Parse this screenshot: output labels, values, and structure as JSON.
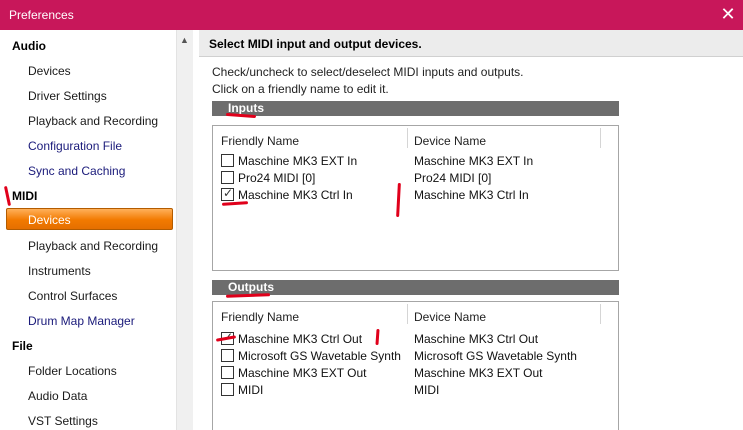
{
  "window": {
    "title": "Preferences",
    "close_icon": "close-icon"
  },
  "sidebar": {
    "sections": [
      {
        "label": "Audio",
        "items": [
          "Devices",
          "Driver Settings",
          "Playback and Recording",
          "Configuration File",
          "Sync and Caching"
        ]
      },
      {
        "label": "MIDI",
        "items": [
          "Devices",
          "Playback and Recording",
          "Instruments",
          "Control Surfaces",
          "Drum Map Manager"
        ]
      },
      {
        "label": "File",
        "items": [
          "Folder Locations",
          "Audio Data",
          "VST Settings"
        ]
      }
    ],
    "selected": "MIDI / Devices"
  },
  "main": {
    "header": "Select MIDI input and output devices.",
    "instructions": [
      "Check/uncheck to select/deselect MIDI inputs and outputs.",
      "Click on a friendly name to edit it."
    ],
    "inputs": {
      "title": "Inputs",
      "col_friendly": "Friendly Name",
      "col_device": "Device Name",
      "rows": [
        {
          "friendly": "Maschine MK3 EXT In",
          "device": "Maschine MK3 EXT In",
          "checked": false
        },
        {
          "friendly": "Pro24 MIDI [0]",
          "device": "Pro24 MIDI [0]",
          "checked": false
        },
        {
          "friendly": "Maschine MK3 Ctrl In",
          "device": "Maschine MK3 Ctrl In",
          "checked": true
        }
      ]
    },
    "outputs": {
      "title": "Outputs",
      "col_friendly": "Friendly Name",
      "col_device": "Device Name",
      "rows": [
        {
          "friendly": "Maschine MK3 Ctrl Out",
          "device": "Maschine MK3 Ctrl Out",
          "checked": true
        },
        {
          "friendly": "Microsoft GS Wavetable Synth",
          "device": "Microsoft GS Wavetable Synth",
          "checked": false
        },
        {
          "friendly": "Maschine MK3 EXT Out",
          "device": "Maschine MK3 EXT Out",
          "checked": false
        },
        {
          "friendly": "MIDI",
          "device": "MIDI",
          "checked": false
        }
      ]
    }
  },
  "colors": {
    "titlebar": "#c8175a",
    "selection": "#f27a00",
    "annotation": "#e0001b"
  }
}
